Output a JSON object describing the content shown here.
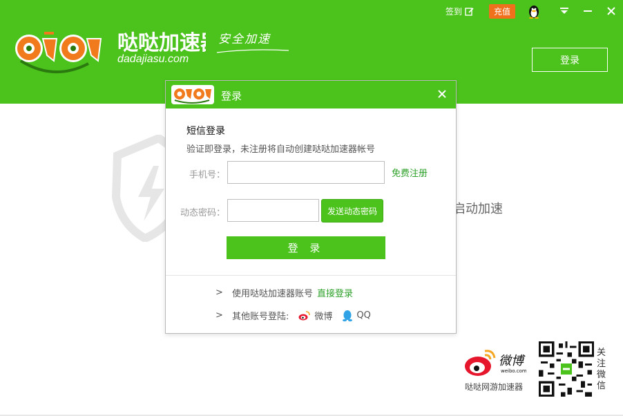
{
  "app": {
    "brand_cn": "哒哒加速器",
    "brand_domain": "dadajiasu.com",
    "slogan": "安全加速"
  },
  "topbar": {
    "signin_label": "签到",
    "recharge_label": "充值"
  },
  "header": {
    "login_button": "登录"
  },
  "background": {
    "status_text": "启动加速"
  },
  "dialog": {
    "title": "登录",
    "sms_title": "短信登录",
    "sms_desc": "验证即登录，未注册将自动创建哒哒加速器帐号",
    "phone_label": "手机号：",
    "phone_value": "",
    "register_link": "免费注册",
    "code_label": "动态密码：",
    "code_value": "",
    "send_code_button": "发送动态密码",
    "login_button": "登 录",
    "account_login_text": "使用哒哒加速器账号",
    "direct_login_link": "直接登录",
    "other_login_text": "其他账号登陆:",
    "weibo_label": "微博",
    "qq_label": "QQ",
    "arrow": ">"
  },
  "footer": {
    "weibo_brand": "微博",
    "weibo_domain": "weibo.com",
    "caption": "哒哒网游加速器",
    "follow_text": "关注微信"
  },
  "colors": {
    "brand_green": "#4cc31c",
    "link_green": "#2ea12a",
    "recharge_orange": "#f0701c"
  },
  "icons": [
    "edit-icon",
    "qq-penguin-icon",
    "dropdown-icon",
    "minimize-icon",
    "close-icon",
    "shield-bolt-icon",
    "weibo-icon",
    "qq-icon",
    "qr-code"
  ]
}
